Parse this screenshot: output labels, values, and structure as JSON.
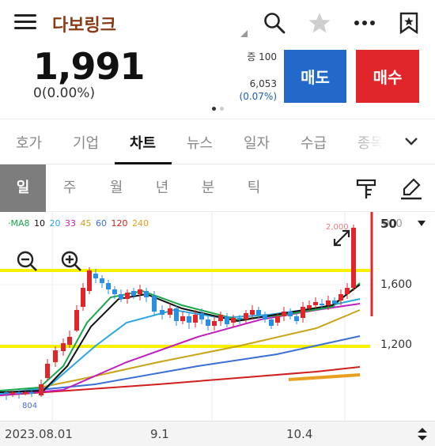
{
  "header": {
    "title": "다보링크",
    "menu_icon": "menu-icon",
    "search_icon": "search-icon",
    "favorite_icon": "star-icon",
    "more_icon": "more-icon",
    "bookmark_icon": "bookmark-icon"
  },
  "quote": {
    "price": "1,991",
    "change": "0(0.00%)"
  },
  "orderbook": {
    "line1": "증 100",
    "volume": "6,053",
    "volume_pct": "(0.07%)"
  },
  "actions": {
    "sell_label": "매도",
    "buy_label": "매수",
    "sell_color": "#2369c9",
    "buy_color": "#e0262b"
  },
  "tabs": [
    {
      "label": "호가"
    },
    {
      "label": "기업"
    },
    {
      "label": "차트",
      "active": true
    },
    {
      "label": "뉴스"
    },
    {
      "label": "일자"
    },
    {
      "label": "수급"
    },
    {
      "label": "종목"
    }
  ],
  "periods": [
    {
      "label": "일",
      "active": true
    },
    {
      "label": "주"
    },
    {
      "label": "월"
    },
    {
      "label": "년"
    },
    {
      "label": "분"
    },
    {
      "label": "틱"
    }
  ],
  "legend": {
    "ma_label": "·MA8",
    "items": [
      {
        "text": "10",
        "color": "#111111"
      },
      {
        "text": "20",
        "color": "#2aa6e0"
      },
      {
        "text": "33",
        "color": "#c020c0"
      },
      {
        "text": "45",
        "color": "#c9a416"
      },
      {
        "text": "60",
        "color": "#3b6fd8"
      },
      {
        "text": "120",
        "color": "#d11e1e"
      },
      {
        "text": "240",
        "color": "#e8a020"
      }
    ]
  },
  "chart_data": {
    "type": "candlestick",
    "x_labels": [
      "2023.08.01",
      "9.1",
      "10.4"
    ],
    "y_ticks": [
      "1,600",
      "1,200"
    ],
    "y_top_label": "000",
    "max_label": "2,000",
    "min_label": "804",
    "zoom_value": "50",
    "horizontal_lines_color": "#f7f000",
    "up_color": "#e0262b",
    "down_color": "#2a8fe0"
  }
}
